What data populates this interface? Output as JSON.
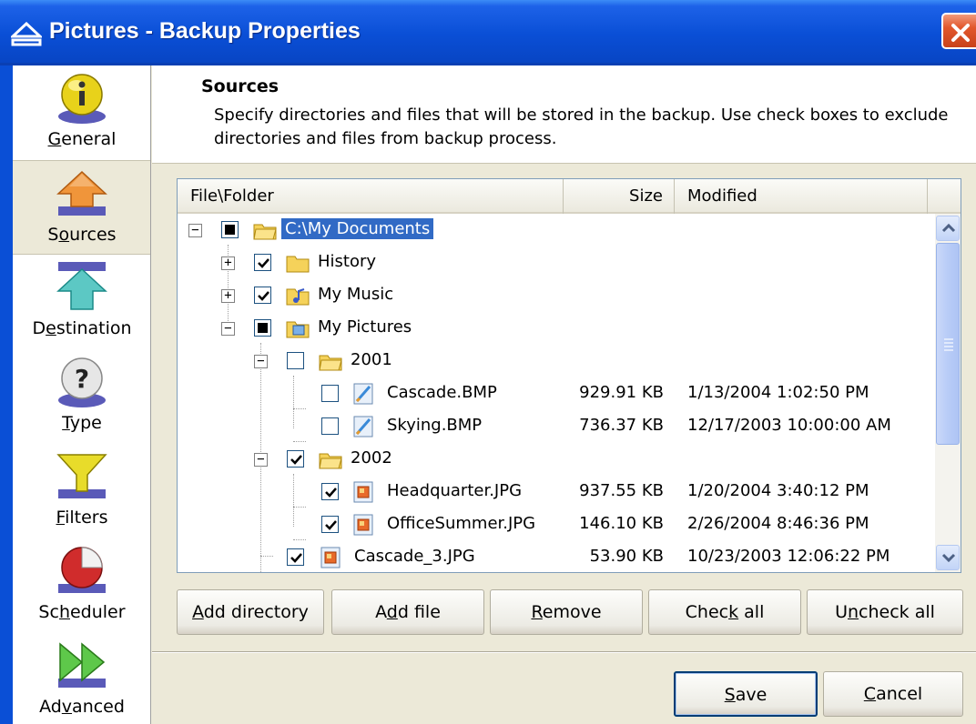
{
  "window": {
    "title": "Pictures - Backup Properties"
  },
  "sidebar": {
    "items": [
      {
        "label_pre": "",
        "label_ul": "G",
        "label_post": "eneral",
        "icon": "info-icon"
      },
      {
        "label_pre": "S",
        "label_ul": "o",
        "label_post": "urces",
        "icon": "up-arrow-orange-icon",
        "active": true
      },
      {
        "label_pre": "D",
        "label_ul": "e",
        "label_post": "stination",
        "icon": "up-arrow-teal-icon"
      },
      {
        "label_pre": "",
        "label_ul": "T",
        "label_post": "ype",
        "icon": "question-icon"
      },
      {
        "label_pre": "",
        "label_ul": "F",
        "label_post": "ilters",
        "icon": "funnel-icon"
      },
      {
        "label_pre": "Sc",
        "label_ul": "h",
        "label_post": "eduler",
        "icon": "pie-clock-icon"
      },
      {
        "label_pre": "Ad",
        "label_ul": "v",
        "label_post": "anced",
        "icon": "fast-forward-icon"
      }
    ]
  },
  "header": {
    "title": "Sources",
    "description": "Specify directories and files that will be stored in the backup. Use check boxes to exclude directories and files from backup process."
  },
  "tree": {
    "columns": [
      "File\\Folder",
      "Size",
      "Modified"
    ],
    "rows": [
      {
        "name": "C:\\My Documents",
        "size": "",
        "modified": ""
      },
      {
        "name": "History",
        "size": "",
        "modified": ""
      },
      {
        "name": "My Music",
        "size": "",
        "modified": ""
      },
      {
        "name": "My Pictures",
        "size": "",
        "modified": ""
      },
      {
        "name": "2001",
        "size": "",
        "modified": ""
      },
      {
        "name": "Cascade.BMP",
        "size": "929.91 KB",
        "modified": "1/13/2004 1:02:50 PM"
      },
      {
        "name": "Skying.BMP",
        "size": "736.37 KB",
        "modified": "12/17/2003 10:00:00 AM"
      },
      {
        "name": "2002",
        "size": "",
        "modified": ""
      },
      {
        "name": "Headquarter.JPG",
        "size": "937.55 KB",
        "modified": "1/20/2004 3:40:12 PM"
      },
      {
        "name": "OfficeSummer.JPG",
        "size": "146.10 KB",
        "modified": "2/26/2004 8:46:36 PM"
      },
      {
        "name": "Cascade_3.JPG",
        "size": "53.90 KB",
        "modified": "10/23/2003 12:06:22 PM"
      }
    ]
  },
  "buttons": {
    "add_directory": {
      "pre": "",
      "ul": "A",
      "post": "dd directory"
    },
    "add_file": {
      "pre": "A",
      "ul": "d",
      "post": "d file"
    },
    "remove": {
      "pre": "",
      "ul": "R",
      "post": "emove"
    },
    "check_all": {
      "pre": "Chec",
      "ul": "k",
      "post": " all"
    },
    "uncheck_all": {
      "pre": "U",
      "ul": "n",
      "post": "check all"
    },
    "save": {
      "pre": "",
      "ul": "S",
      "post": "ave"
    },
    "cancel": {
      "pre": "",
      "ul": "C",
      "post": "ancel"
    }
  },
  "colors": {
    "titlebar": "#0a4fd6",
    "selection": "#316ac5",
    "close": "#e2572c"
  }
}
